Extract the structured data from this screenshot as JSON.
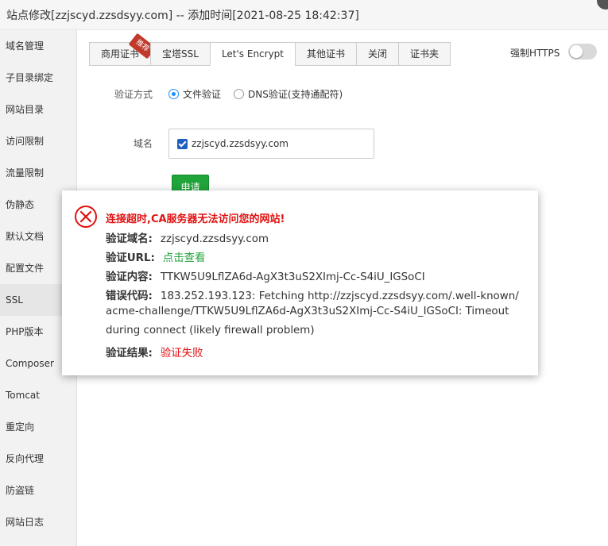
{
  "window": {
    "title": "站点修改[zzjscyd.zzsdsyy.com] -- 添加时间[2021-08-25 18:42:37]"
  },
  "sidebar": {
    "items": [
      {
        "label": "域名管理"
      },
      {
        "label": "子目录绑定"
      },
      {
        "label": "网站目录"
      },
      {
        "label": "访问限制"
      },
      {
        "label": "流量限制"
      },
      {
        "label": "伪静态"
      },
      {
        "label": "默认文档"
      },
      {
        "label": "配置文件"
      },
      {
        "label": "SSL"
      },
      {
        "label": "PHP版本"
      },
      {
        "label": "Composer"
      },
      {
        "label": "Tomcat"
      },
      {
        "label": "重定向"
      },
      {
        "label": "反向代理"
      },
      {
        "label": "防盗链"
      },
      {
        "label": "网站日志"
      }
    ],
    "active": "SSL"
  },
  "tabs": {
    "items": [
      {
        "label": "商用证书",
        "badge": "推荐"
      },
      {
        "label": "宝塔SSL"
      },
      {
        "label": "Let's Encrypt"
      },
      {
        "label": "其他证书"
      },
      {
        "label": "关闭"
      },
      {
        "label": "证书夹"
      }
    ],
    "active": "Let's Encrypt"
  },
  "force_https": {
    "label": "强制HTTPS",
    "enabled": false
  },
  "form": {
    "verify_label": "验证方式",
    "verify_options": [
      "文件验证",
      "DNS验证(支持通配符)"
    ],
    "verify_selected": "文件验证",
    "domain_label": "域名",
    "domain_value": "zzjscyd.zzsdsyy.com",
    "domain_checked": true,
    "apply_label": "申请"
  },
  "error": {
    "title": "连接超时,CA服务器无法访问您的网站!",
    "domain_key": "验证域名:",
    "domain_val": "zzjscyd.zzsdsyy.com",
    "url_key": "验证URL:",
    "url_val": "点击查看",
    "content_key": "验证内容:",
    "content_val": "TTKW5U9LflZA6d-AgX3t3uS2XImj-Cc-S4iU_IGSoCI",
    "code_key": "错误代码:",
    "code_line1": "183.252.193.123: Fetching http://zzjscyd.zzsdsyy.com/.well-known/",
    "code_line2": "acme-challenge/TTKW5U9LflZA6d-AgX3t3uS2XImj-Cc-S4iU_IGSoCI: Timeout",
    "code_line3": "during connect (likely firewall problem)",
    "result_key": "验证结果:",
    "result_val": "验证失败"
  },
  "colors": {
    "accent_green": "#20a53a",
    "error_red": "#e01010",
    "radio_blue": "#1e90ff"
  }
}
